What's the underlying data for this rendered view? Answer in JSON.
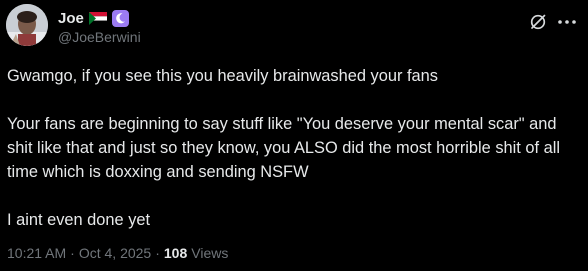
{
  "author": {
    "display_name": "Joe",
    "handle": "@JoeBerwini",
    "flag_icon": "sudan-flag-icon",
    "badge_icon": "moon-badge-icon"
  },
  "actions": {
    "grok_icon": "grok-icon",
    "more_icon": "more-horizontal-icon"
  },
  "tweet": {
    "paragraphs": [
      "Gwamgo, if you see this you heavily brainwashed your fans",
      "Your fans are beginning to say stuff like \"You deserve your mental scar\" and shit like that and just so they know, you ALSO did the most horrible shit of all time which is doxxing and sending NSFW",
      "I aint even done yet"
    ]
  },
  "meta": {
    "time": "10:21 AM",
    "separator": "·",
    "date": "Oct 4, 2025",
    "views_count": "108",
    "views_label": "Views"
  },
  "colors": {
    "background": "#000000",
    "text": "#e7e9ea",
    "secondary_text": "#71767b",
    "badge": "#9b7bf2"
  }
}
